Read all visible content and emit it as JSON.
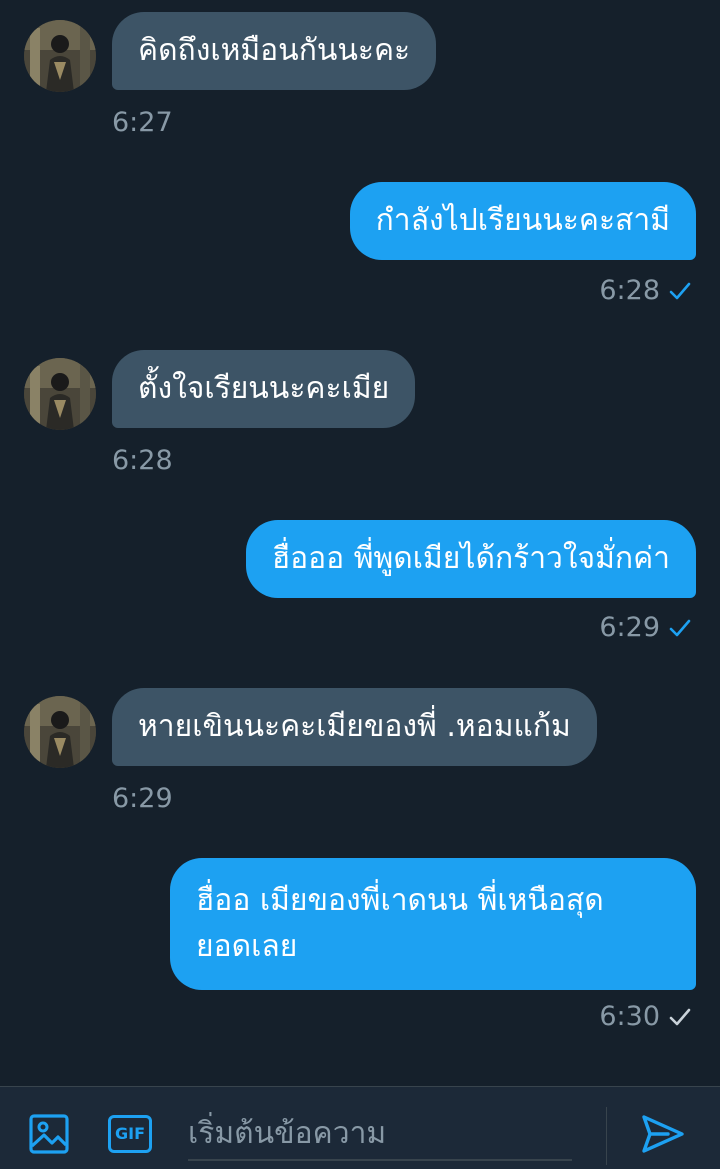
{
  "messages": [
    {
      "direction": "in",
      "text": "คิดถึงเหมือนกันนะคะ",
      "time": "6:27"
    },
    {
      "direction": "out",
      "text": "กำลังไปเรียนนะคะสามี",
      "time": "6:28",
      "status": "delivered"
    },
    {
      "direction": "in",
      "text": "ตั้งใจเรียนนะคะเมีย",
      "time": "6:28"
    },
    {
      "direction": "out",
      "text": "ฮื่อออ พี่พูดเมียได้กร้าวใจมั่กค่า",
      "time": "6:29",
      "status": "delivered"
    },
    {
      "direction": "in",
      "text": "หายเขินนะคะเมียของพี่ .หอมแก้ม",
      "time": "6:29"
    },
    {
      "direction": "out",
      "text_lines": [
        "ฮื่ออ เมียของพี่เาดนน พี่เหนือสุด",
        "ยอดเลย"
      ],
      "time": "6:30",
      "status": "sent"
    }
  ],
  "composer": {
    "placeholder": "เริ่มต้นข้อความ",
    "gif_label": "GIF",
    "image_icon": "image-icon",
    "send_icon": "send-icon"
  },
  "colors": {
    "background": "#15202b",
    "incoming_bubble": "#3d5466",
    "outgoing_bubble": "#1da1f2",
    "timestamp": "#8899a6",
    "delivered_check": "#1da1f2",
    "sent_check": "#c9d2d9",
    "accent": "#1da1f2"
  }
}
